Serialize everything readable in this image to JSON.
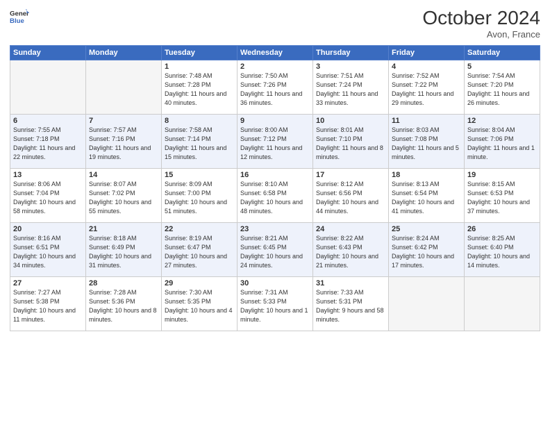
{
  "header": {
    "logo_text_line1": "General",
    "logo_text_line2": "Blue",
    "month": "October 2024",
    "location": "Avon, France"
  },
  "weekdays": [
    "Sunday",
    "Monday",
    "Tuesday",
    "Wednesday",
    "Thursday",
    "Friday",
    "Saturday"
  ],
  "weeks": [
    [
      {
        "day": "",
        "info": ""
      },
      {
        "day": "",
        "info": ""
      },
      {
        "day": "1",
        "info": "Sunrise: 7:48 AM\nSunset: 7:28 PM\nDaylight: 11 hours and 40 minutes."
      },
      {
        "day": "2",
        "info": "Sunrise: 7:50 AM\nSunset: 7:26 PM\nDaylight: 11 hours and 36 minutes."
      },
      {
        "day": "3",
        "info": "Sunrise: 7:51 AM\nSunset: 7:24 PM\nDaylight: 11 hours and 33 minutes."
      },
      {
        "day": "4",
        "info": "Sunrise: 7:52 AM\nSunset: 7:22 PM\nDaylight: 11 hours and 29 minutes."
      },
      {
        "day": "5",
        "info": "Sunrise: 7:54 AM\nSunset: 7:20 PM\nDaylight: 11 hours and 26 minutes."
      }
    ],
    [
      {
        "day": "6",
        "info": "Sunrise: 7:55 AM\nSunset: 7:18 PM\nDaylight: 11 hours and 22 minutes."
      },
      {
        "day": "7",
        "info": "Sunrise: 7:57 AM\nSunset: 7:16 PM\nDaylight: 11 hours and 19 minutes."
      },
      {
        "day": "8",
        "info": "Sunrise: 7:58 AM\nSunset: 7:14 PM\nDaylight: 11 hours and 15 minutes."
      },
      {
        "day": "9",
        "info": "Sunrise: 8:00 AM\nSunset: 7:12 PM\nDaylight: 11 hours and 12 minutes."
      },
      {
        "day": "10",
        "info": "Sunrise: 8:01 AM\nSunset: 7:10 PM\nDaylight: 11 hours and 8 minutes."
      },
      {
        "day": "11",
        "info": "Sunrise: 8:03 AM\nSunset: 7:08 PM\nDaylight: 11 hours and 5 minutes."
      },
      {
        "day": "12",
        "info": "Sunrise: 8:04 AM\nSunset: 7:06 PM\nDaylight: 11 hours and 1 minute."
      }
    ],
    [
      {
        "day": "13",
        "info": "Sunrise: 8:06 AM\nSunset: 7:04 PM\nDaylight: 10 hours and 58 minutes."
      },
      {
        "day": "14",
        "info": "Sunrise: 8:07 AM\nSunset: 7:02 PM\nDaylight: 10 hours and 55 minutes."
      },
      {
        "day": "15",
        "info": "Sunrise: 8:09 AM\nSunset: 7:00 PM\nDaylight: 10 hours and 51 minutes."
      },
      {
        "day": "16",
        "info": "Sunrise: 8:10 AM\nSunset: 6:58 PM\nDaylight: 10 hours and 48 minutes."
      },
      {
        "day": "17",
        "info": "Sunrise: 8:12 AM\nSunset: 6:56 PM\nDaylight: 10 hours and 44 minutes."
      },
      {
        "day": "18",
        "info": "Sunrise: 8:13 AM\nSunset: 6:54 PM\nDaylight: 10 hours and 41 minutes."
      },
      {
        "day": "19",
        "info": "Sunrise: 8:15 AM\nSunset: 6:53 PM\nDaylight: 10 hours and 37 minutes."
      }
    ],
    [
      {
        "day": "20",
        "info": "Sunrise: 8:16 AM\nSunset: 6:51 PM\nDaylight: 10 hours and 34 minutes."
      },
      {
        "day": "21",
        "info": "Sunrise: 8:18 AM\nSunset: 6:49 PM\nDaylight: 10 hours and 31 minutes."
      },
      {
        "day": "22",
        "info": "Sunrise: 8:19 AM\nSunset: 6:47 PM\nDaylight: 10 hours and 27 minutes."
      },
      {
        "day": "23",
        "info": "Sunrise: 8:21 AM\nSunset: 6:45 PM\nDaylight: 10 hours and 24 minutes."
      },
      {
        "day": "24",
        "info": "Sunrise: 8:22 AM\nSunset: 6:43 PM\nDaylight: 10 hours and 21 minutes."
      },
      {
        "day": "25",
        "info": "Sunrise: 8:24 AM\nSunset: 6:42 PM\nDaylight: 10 hours and 17 minutes."
      },
      {
        "day": "26",
        "info": "Sunrise: 8:25 AM\nSunset: 6:40 PM\nDaylight: 10 hours and 14 minutes."
      }
    ],
    [
      {
        "day": "27",
        "info": "Sunrise: 7:27 AM\nSunset: 5:38 PM\nDaylight: 10 hours and 11 minutes."
      },
      {
        "day": "28",
        "info": "Sunrise: 7:28 AM\nSunset: 5:36 PM\nDaylight: 10 hours and 8 minutes."
      },
      {
        "day": "29",
        "info": "Sunrise: 7:30 AM\nSunset: 5:35 PM\nDaylight: 10 hours and 4 minutes."
      },
      {
        "day": "30",
        "info": "Sunrise: 7:31 AM\nSunset: 5:33 PM\nDaylight: 10 hours and 1 minute."
      },
      {
        "day": "31",
        "info": "Sunrise: 7:33 AM\nSunset: 5:31 PM\nDaylight: 9 hours and 58 minutes."
      },
      {
        "day": "",
        "info": ""
      },
      {
        "day": "",
        "info": ""
      }
    ]
  ]
}
